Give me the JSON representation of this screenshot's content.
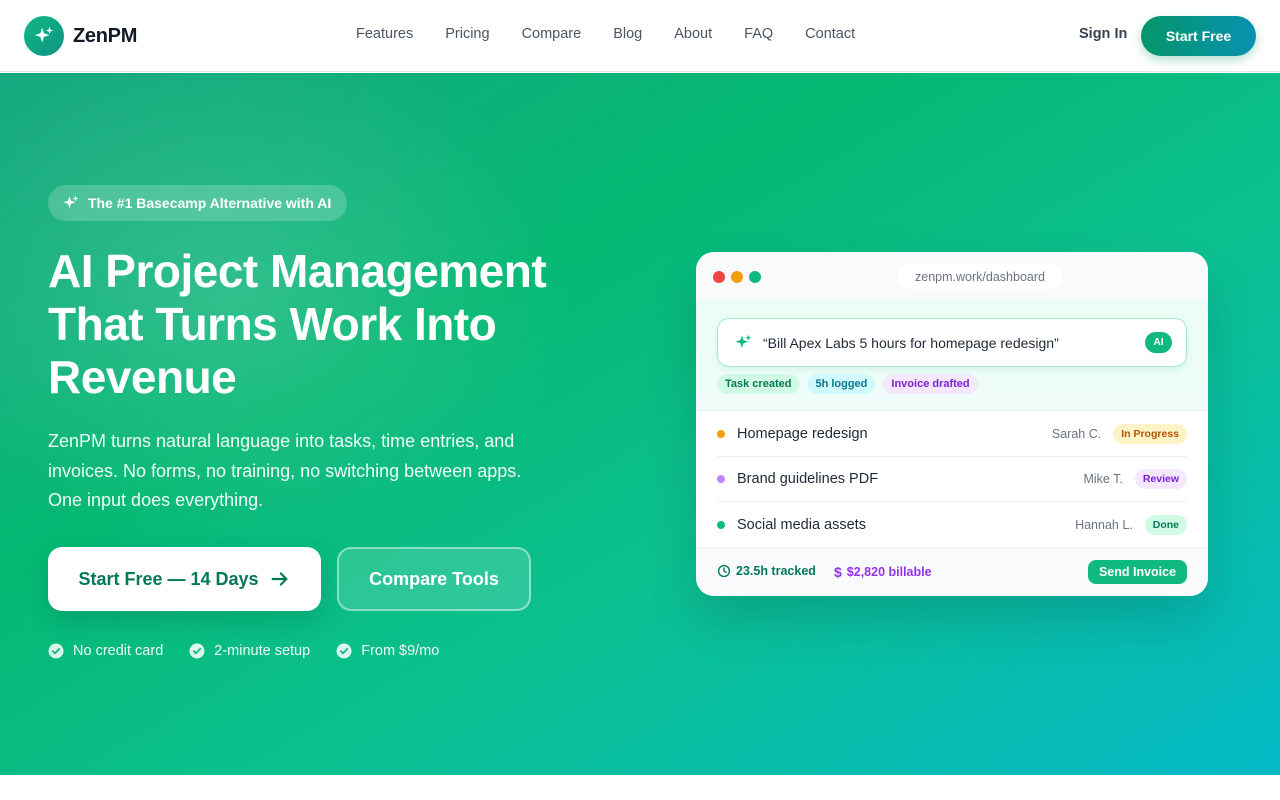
{
  "brand": {
    "name": "ZenPM"
  },
  "nav": {
    "links": [
      "Features",
      "Pricing",
      "Compare",
      "Blog",
      "About",
      "FAQ",
      "Contact"
    ],
    "sign_in": "Sign In",
    "cta": "Start Free"
  },
  "hero": {
    "badge": "The #1 Basecamp Alternative with AI",
    "headline": {
      "line1": "AI Project Management",
      "line2": "That Turns Work Into",
      "line3": "Revenue"
    },
    "subtext": {
      "line1": "ZenPM turns natural language into tasks, time entries, and",
      "line2": "invoices. No forms, no training, no switching between apps.",
      "line3": "One input does everything."
    },
    "primary_cta": "Start Free — 14 Days",
    "secondary_cta": "Compare Tools",
    "trust": [
      "No credit card",
      "2-minute setup",
      "From $9/mo"
    ]
  },
  "mockup": {
    "url": "zenpm.work/dashboard",
    "ai_prompt": "“Bill Apex Labs 5 hours for homepage redesign”",
    "ai_badge": "AI",
    "chips": [
      {
        "label": "Task created",
        "bg": "#d1fae5",
        "color": "#047857"
      },
      {
        "label": "5h logged",
        "bg": "#cffafe",
        "color": "#0e7490"
      },
      {
        "label": "Invoice drafted",
        "bg": "#f3e8ff",
        "color": "#7e22ce"
      }
    ],
    "tasks": [
      {
        "name": "Homepage redesign",
        "assignee": "Sarah C.",
        "status": "In Progress",
        "dot": "#f59e0b",
        "status_bg": "#fef3c7",
        "status_color": "#b45309"
      },
      {
        "name": "Brand guidelines PDF",
        "assignee": "Mike T.",
        "status": "Review",
        "dot": "#c084fc",
        "status_bg": "#f3e8ff",
        "status_color": "#7e22ce"
      },
      {
        "name": "Social media assets",
        "assignee": "Hannah L.",
        "status": "Done",
        "dot": "#10b981",
        "status_bg": "#d1fae5",
        "status_color": "#047857"
      }
    ],
    "footer": {
      "tracked": "23.5h tracked",
      "billable": "$2,820 billable",
      "send": "Send Invoice"
    },
    "window_dots": [
      "#ef4444",
      "#f59e0b",
      "#10b981"
    ]
  },
  "colors": {
    "accent": "#10b981",
    "accent_dark": "#047857",
    "teal": "#0891b2",
    "billable_purple": "#9333ea"
  }
}
